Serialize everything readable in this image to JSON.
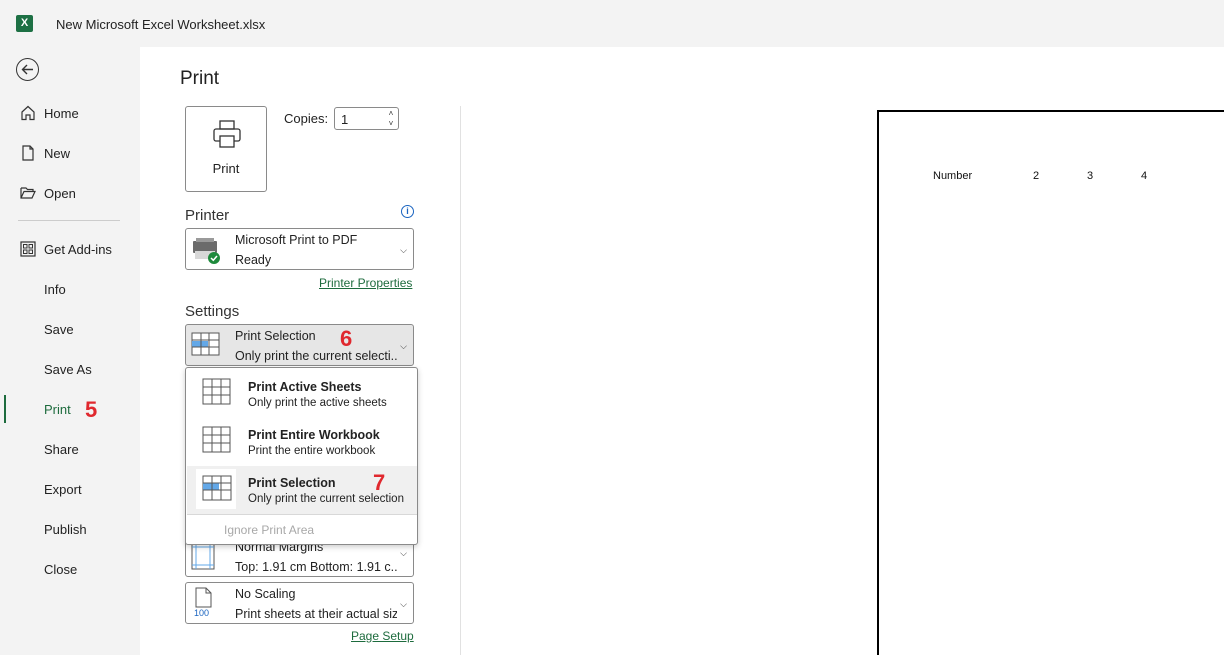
{
  "titlebar": {
    "app_icon": "excel-logo",
    "icon_letter": "X",
    "title": "New Microsoft Excel Worksheet.xlsx"
  },
  "nav": {
    "back_icon": "back-arrow-icon",
    "home": "Home",
    "new": "New",
    "open": "Open",
    "get_addins": "Get Add-ins",
    "info": "Info",
    "save": "Save",
    "save_as": "Save As",
    "print": "Print",
    "share": "Share",
    "export": "Export",
    "publish": "Publish",
    "close": "Close",
    "print_marker": "5",
    "active_color": "#1d6b3d"
  },
  "print": {
    "page_title": "Print",
    "print_button_label": "Print",
    "copies_label": "Copies:",
    "copies_value": "1"
  },
  "printer": {
    "header": "Printer",
    "name": "Microsoft Print to PDF",
    "status": "Ready",
    "properties_link": "Printer Properties"
  },
  "settings": {
    "header": "Settings",
    "selection_title": "Print Selection",
    "selection_sub": "Only print the current selecti...",
    "selection_marker": "6",
    "margins_title": "Normal Margins",
    "margins_sub": "Top: 1.91 cm Bottom: 1.91 c...",
    "scaling_title": "No Scaling",
    "scaling_sub": "Print sheets at their actual size",
    "scaling_icon_text": "100",
    "page_setup_link": "Page Setup"
  },
  "popup": {
    "items": [
      {
        "title": "Print Active Sheets",
        "sub": "Only print the active sheets"
      },
      {
        "title": "Print Entire Workbook",
        "sub": "Print the entire workbook"
      },
      {
        "title": "Print Selection",
        "sub": "Only print the current selection"
      }
    ],
    "selection_marker": "7",
    "ignore_print_area": "Ignore Print Area"
  },
  "preview": {
    "cells": [
      "Number",
      "2",
      "3",
      "4"
    ]
  }
}
